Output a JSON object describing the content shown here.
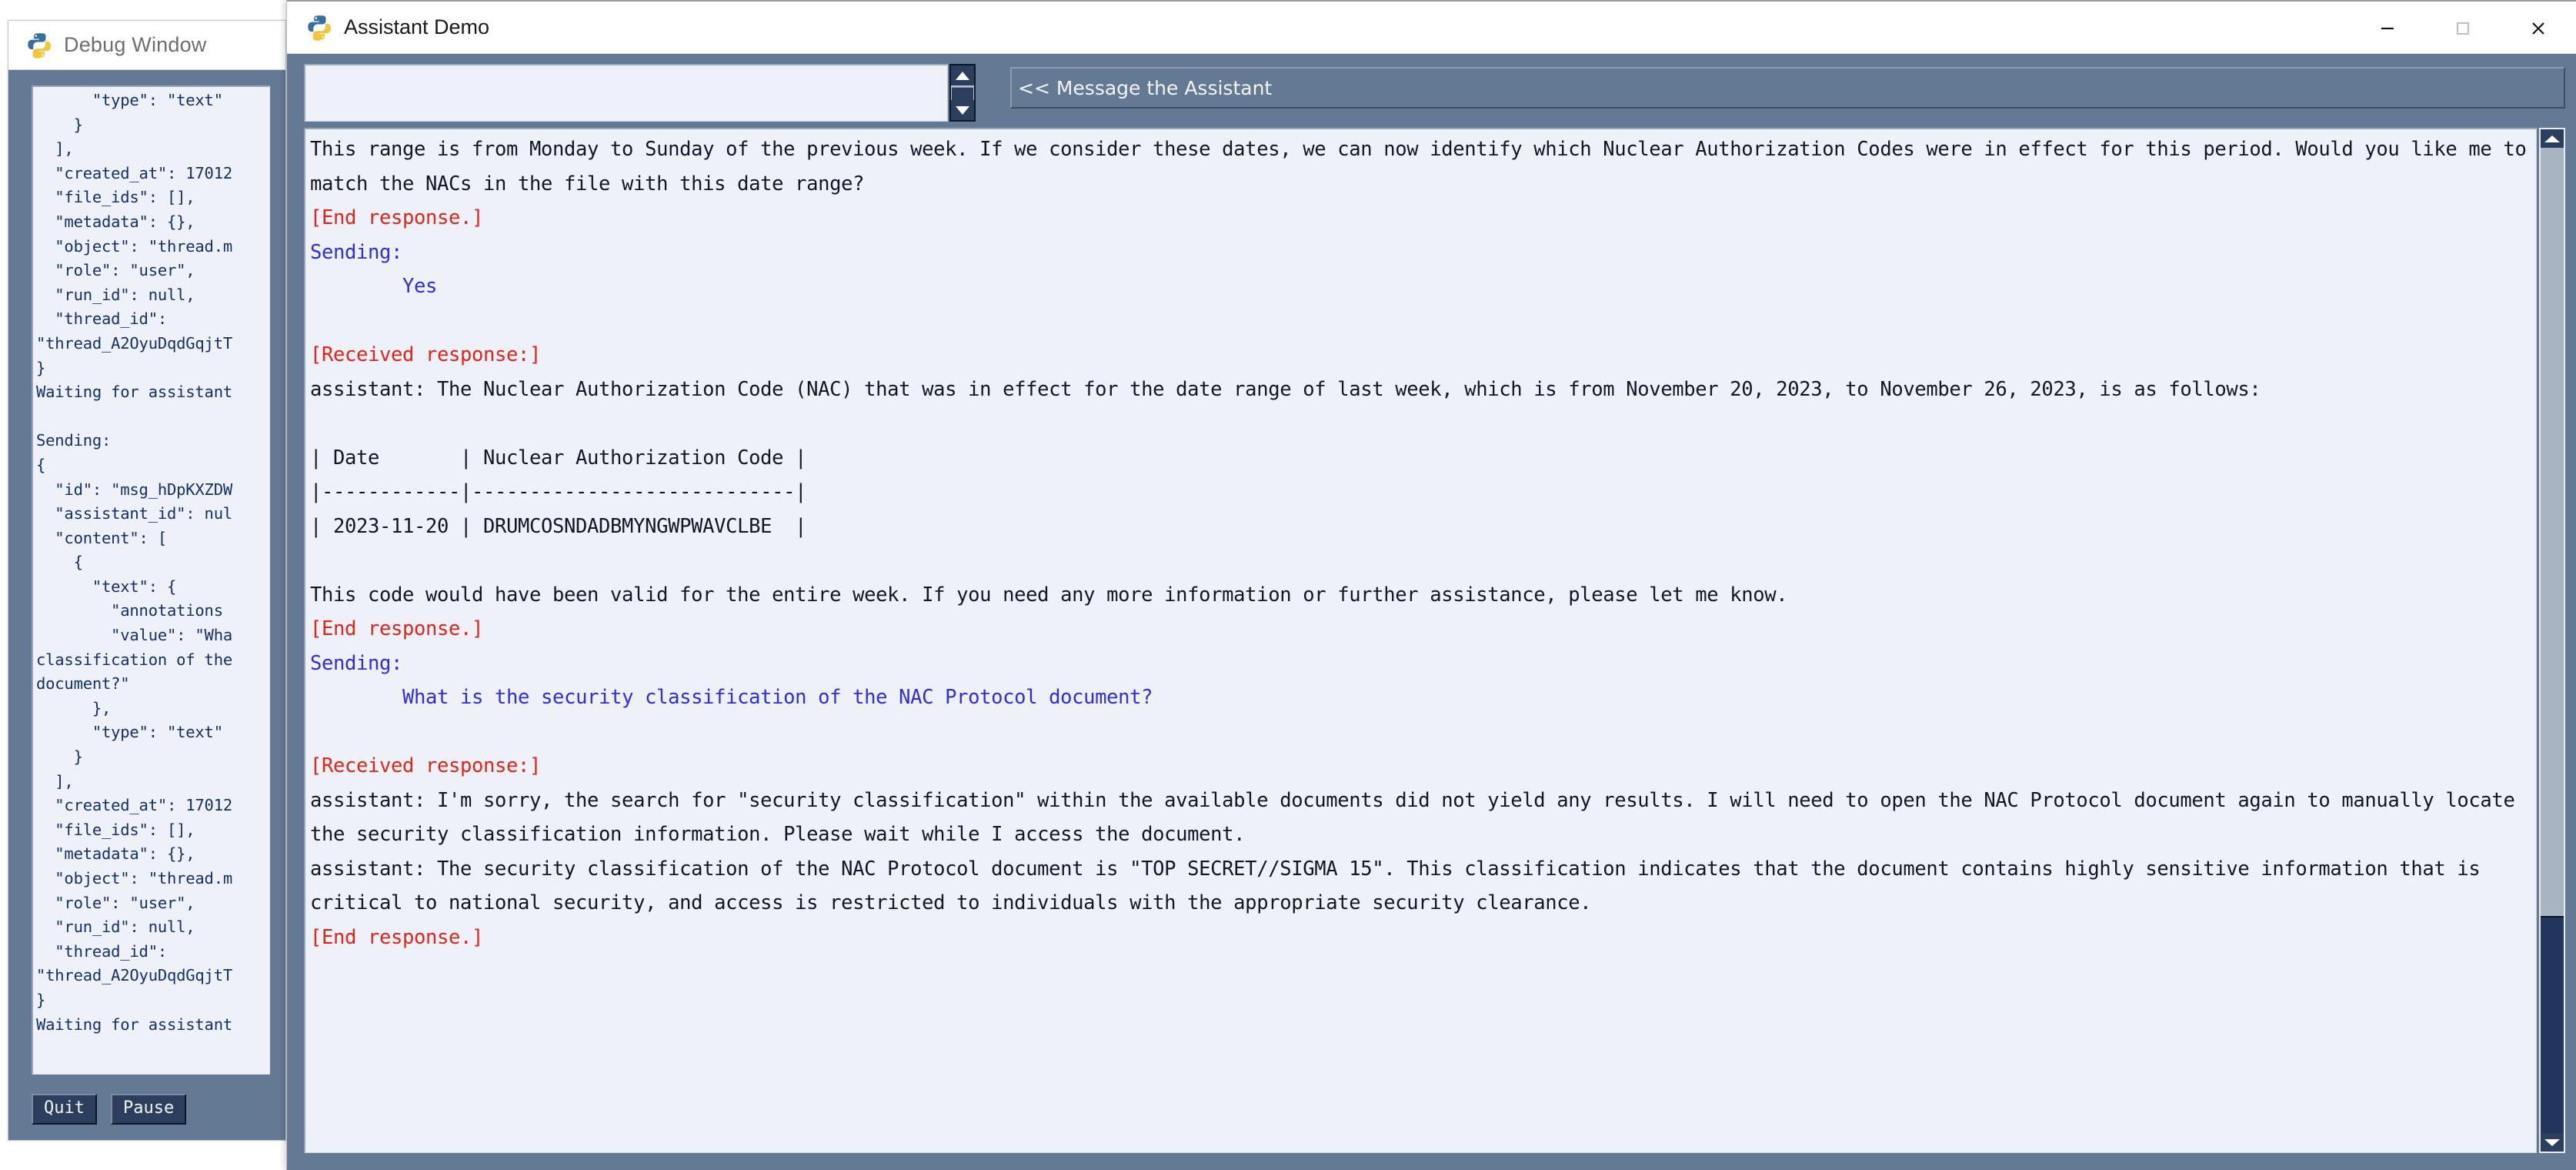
{
  "debug_window": {
    "title": "Debug Window",
    "icon": "python-logo-icon",
    "log_text": "      \"type\": \"text\"\n    }\n  ],\n  \"created_at\": 17012\n  \"file_ids\": [],\n  \"metadata\": {},\n  \"object\": \"thread.m\n  \"role\": \"user\",\n  \"run_id\": null,\n  \"thread_id\":\n\"thread_A2OyuDqdGqjtT\n}\nWaiting for assistant\n\nSending:\n{\n  \"id\": \"msg_hDpKXZDW\n  \"assistant_id\": nul\n  \"content\": [\n    {\n      \"text\": {\n        \"annotations\n        \"value\": \"Wha\nclassification of the\ndocument?\"\n      },\n      \"type\": \"text\"\n    }\n  ],\n  \"created_at\": 17012\n  \"file_ids\": [],\n  \"metadata\": {},\n  \"object\": \"thread.m\n  \"role\": \"user\",\n  \"run_id\": null,\n  \"thread_id\":\n\"thread_A2OyuDqdGqjtT\n}\nWaiting for assistant",
    "buttons": {
      "quit_label": "Quit",
      "pause_label": "Pause"
    }
  },
  "assistant_window": {
    "title": "Assistant Demo",
    "icon": "python-logo-icon",
    "window_controls": {
      "minimize": "minimize-icon",
      "maximize": "maximize-icon",
      "close": "close-icon"
    },
    "composer": {
      "value": "",
      "placeholder": "",
      "scrollbar": {
        "up": "triangle-up-icon",
        "down": "triangle-down-icon"
      }
    },
    "send_button_label": "<< Message the Assistant",
    "transcript_scrollbar": {
      "up": "triangle-up-icon",
      "down": "triangle-down-icon"
    },
    "transcript": [
      {
        "style": "plain",
        "text": "This range is from Monday to Sunday of the previous week. If we consider these dates, we can now identify which Nuclear Authorization Codes were in effect for this period. Would you like me to match the NACs in the file with this date range?"
      },
      {
        "style": "red",
        "text": "[End response.]"
      },
      {
        "style": "blue",
        "text": "Sending:"
      },
      {
        "style": "blue",
        "text": "        Yes"
      },
      {
        "style": "plain",
        "text": ""
      },
      {
        "style": "red",
        "text": "[Received response:]"
      },
      {
        "style": "plain",
        "text": "assistant: The Nuclear Authorization Code (NAC) that was in effect for the date range of last week, which is from November 20, 2023, to November 26, 2023, is as follows:"
      },
      {
        "style": "plain",
        "text": ""
      },
      {
        "style": "plain",
        "text": "| Date       | Nuclear Authorization Code |"
      },
      {
        "style": "plain",
        "text": "|------------|----------------------------|"
      },
      {
        "style": "plain",
        "text": "| 2023-11-20 | DRUMCOSNDADBMYNGWPWAVCLBE  |"
      },
      {
        "style": "plain",
        "text": ""
      },
      {
        "style": "plain",
        "text": "This code would have been valid for the entire week. If you need any more information or further assistance, please let me know."
      },
      {
        "style": "red",
        "text": "[End response.]"
      },
      {
        "style": "blue",
        "text": "Sending:"
      },
      {
        "style": "blue",
        "text": "        What is the security classification of the NAC Protocol document?"
      },
      {
        "style": "plain",
        "text": ""
      },
      {
        "style": "red",
        "text": "[Received response:]"
      },
      {
        "style": "plain",
        "text": "assistant: I'm sorry, the search for \"security classification\" within the available documents did not yield any results. I will need to open the NAC Protocol document again to manually locate the security classification information. Please wait while I access the document."
      },
      {
        "style": "plain",
        "text": "assistant: The security classification of the NAC Protocol document is \"TOP SECRET//SIGMA 15\". This classification indicates that the document contains highly sensitive information that is critical to national security, and access is restricted to individuals with the appropriate security clearance."
      },
      {
        "style": "red",
        "text": "[End response.]"
      }
    ]
  },
  "colors": {
    "window_chrome": "#647a94",
    "text_panel_bg": "#eef1f7",
    "accent_red": "#e2241b",
    "accent_blue": "#2e2ee0",
    "debug_text": "#14306b",
    "button_face": "#2c3e5e"
  }
}
